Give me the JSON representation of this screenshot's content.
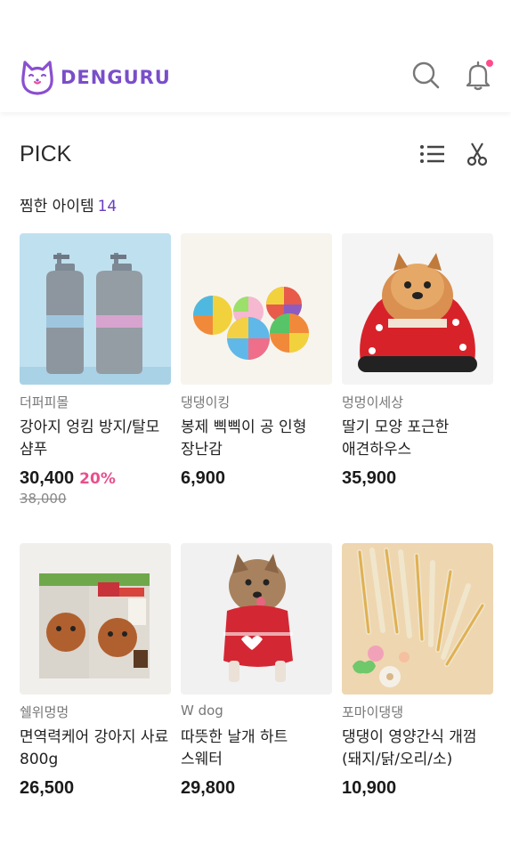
{
  "header": {
    "logo_text": "DENGURU"
  },
  "pick": {
    "title": "PICK"
  },
  "saved": {
    "label": "찜한 아이템",
    "count": "14"
  },
  "products": [
    {
      "brand": "더퍼피몰",
      "name": "강아지 엉킴 방지/탈모 샴푸",
      "price": "30,400",
      "discount": "20%",
      "original": "38,000",
      "image": "shampoo-bottles"
    },
    {
      "brand": "댕댕이킹",
      "name": "봉제 삑삑이 공 인형 장난감",
      "price": "6,900",
      "discount": "",
      "original": "",
      "image": "colorful-balls"
    },
    {
      "brand": "멍멍이세상",
      "name": "딸기 모양 포근한 애견하우스",
      "price": "35,900",
      "discount": "",
      "original": "",
      "image": "strawberry-house-pomeranian"
    },
    {
      "brand": "쉘위멍멍",
      "name": "면역력케어 강아지 사료 800g",
      "price": "26,500",
      "discount": "",
      "original": "",
      "image": "dog-food-bags"
    },
    {
      "brand": "W dog",
      "name": "따뜻한 날개 하트 스웨터",
      "price": "29,800",
      "discount": "",
      "original": "",
      "image": "red-sweater-pomeranian"
    },
    {
      "brand": "포마이댕댕",
      "name": "댕댕이 영양간식 개껌(돼지/닭/오리/소)",
      "price": "10,900",
      "discount": "",
      "original": "",
      "image": "chew-sticks"
    }
  ],
  "colors": {
    "accent": "#6a3ec0",
    "discount": "#e8508e",
    "notification": "#ff4b8c"
  }
}
